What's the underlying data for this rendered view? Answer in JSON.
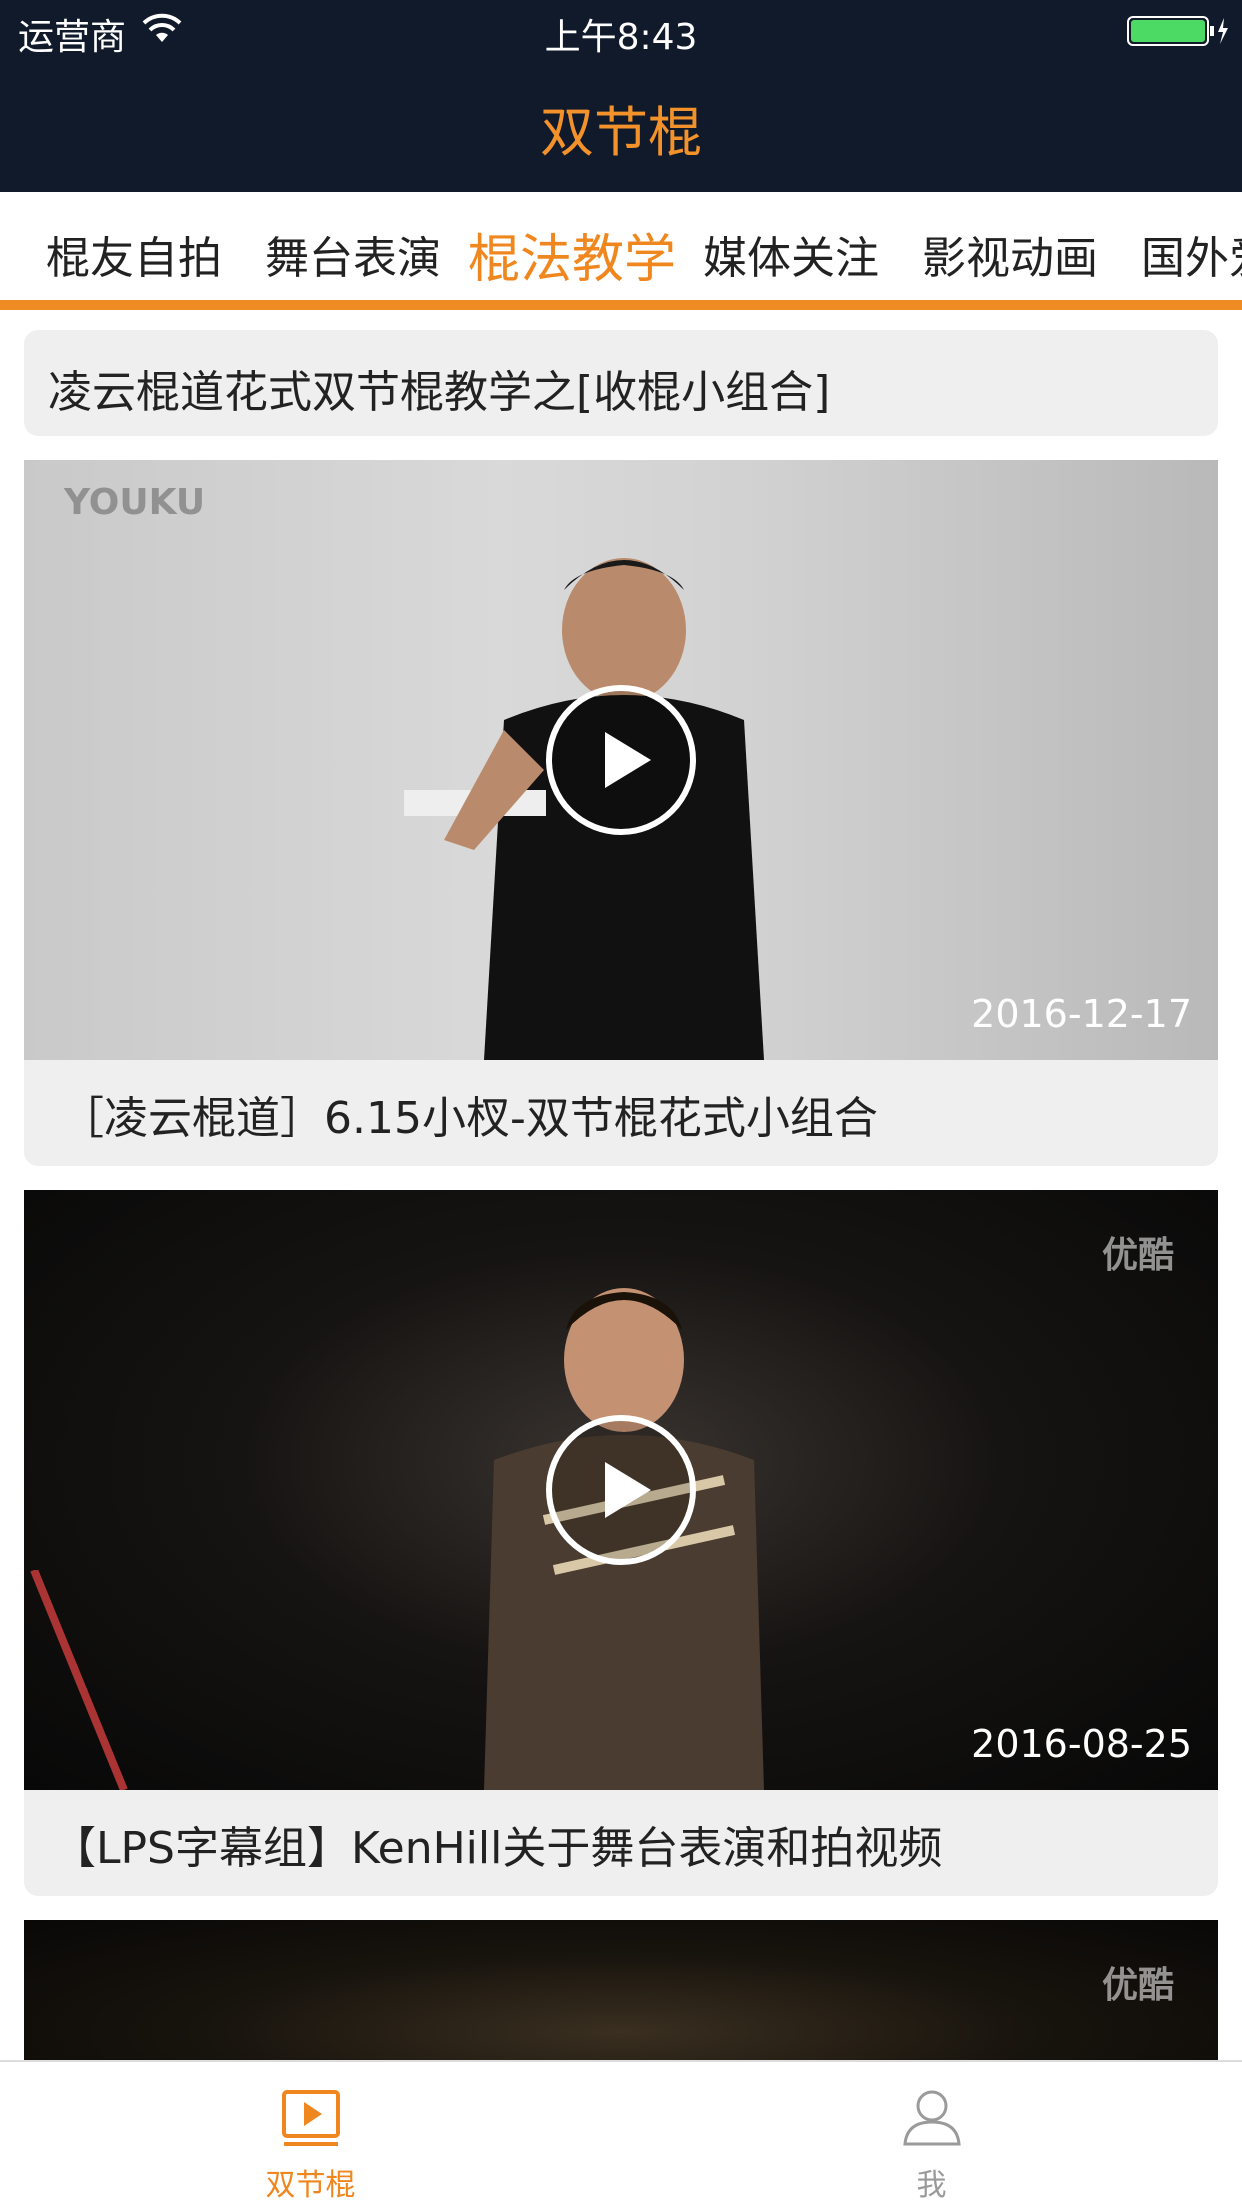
{
  "status_bar": {
    "carrier": "运营商",
    "time": "上午8:43"
  },
  "nav": {
    "title": "双节棍"
  },
  "category_tabs": [
    {
      "label": "棍友自拍",
      "active": false
    },
    {
      "label": "舞台表演",
      "active": false
    },
    {
      "label": "棍法教学",
      "active": true
    },
    {
      "label": "媒体关注",
      "active": false
    },
    {
      "label": "影视动画",
      "active": false
    },
    {
      "label": "国外爱好者",
      "active": false
    }
  ],
  "feed": {
    "header_title": "凌云棍道花式双节棍教学之[收棍小组合]",
    "items": [
      {
        "title": "［凌云棍道］6.15小杈-双节棍花式小组合",
        "date": "2016-12-17",
        "watermark": "YOUKU"
      },
      {
        "title": "【LPS字幕组】KenHill关于舞台表演和拍视频",
        "date": "2016-08-25",
        "watermark": "优酷"
      },
      {
        "title": "",
        "date": "",
        "watermark": "优酷"
      }
    ]
  },
  "bottom_tabs": [
    {
      "label": "双节棍",
      "icon": "play-icon",
      "active": true
    },
    {
      "label": "我",
      "icon": "person-icon",
      "active": false
    }
  ],
  "colors": {
    "accent": "#f0861e",
    "header_bg": "#101a2b",
    "card_bg": "#efefef",
    "inactive": "#9a9a9a"
  }
}
